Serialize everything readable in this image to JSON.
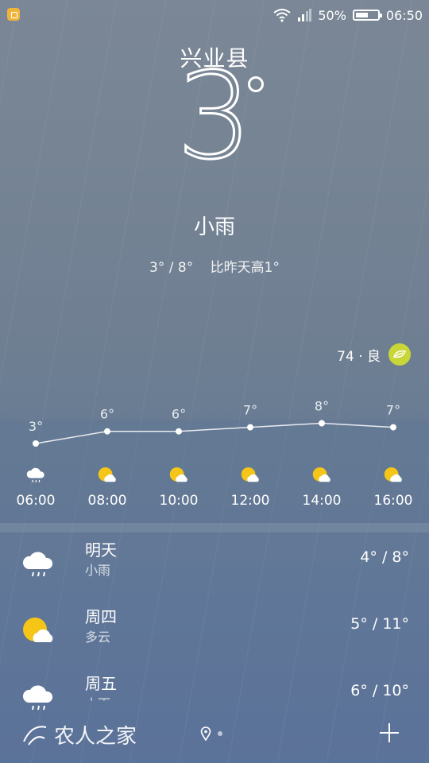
{
  "status": {
    "battery_percent": "50%",
    "time": "06:50"
  },
  "current": {
    "city": "兴业县",
    "temperature": "3",
    "condition": "小雨",
    "range": "3° / 8°",
    "compare": "比昨天高1°",
    "aqi": "74 · 良"
  },
  "hourly": [
    {
      "time": "06:00",
      "temp": 3,
      "temp_label": "3°",
      "icon": "rain-cloud-icon"
    },
    {
      "time": "08:00",
      "temp": 6,
      "temp_label": "6°",
      "icon": "partly-cloudy-icon"
    },
    {
      "time": "10:00",
      "temp": 6,
      "temp_label": "6°",
      "icon": "partly-cloudy-icon"
    },
    {
      "time": "12:00",
      "temp": 7,
      "temp_label": "7°",
      "icon": "partly-cloudy-icon"
    },
    {
      "time": "14:00",
      "temp": 8,
      "temp_label": "8°",
      "icon": "partly-cloudy-icon"
    },
    {
      "time": "16:00",
      "temp": 7,
      "temp_label": "7°",
      "icon": "partly-cloudy-icon"
    }
  ],
  "daily": [
    {
      "day": "明天",
      "condition": "小雨",
      "range": "4° / 8°",
      "icon": "rain-cloud-icon"
    },
    {
      "day": "周四",
      "condition": "多云",
      "range": "5° / 11°",
      "icon": "partly-cloudy-icon"
    },
    {
      "day": "周五",
      "condition": "小雨",
      "range": "6° / 10°",
      "icon": "rain-cloud-icon"
    }
  ],
  "watermark": "农人之家",
  "colors": {
    "sun": "#f5c518",
    "aqi_leaf": "#c8d638"
  }
}
